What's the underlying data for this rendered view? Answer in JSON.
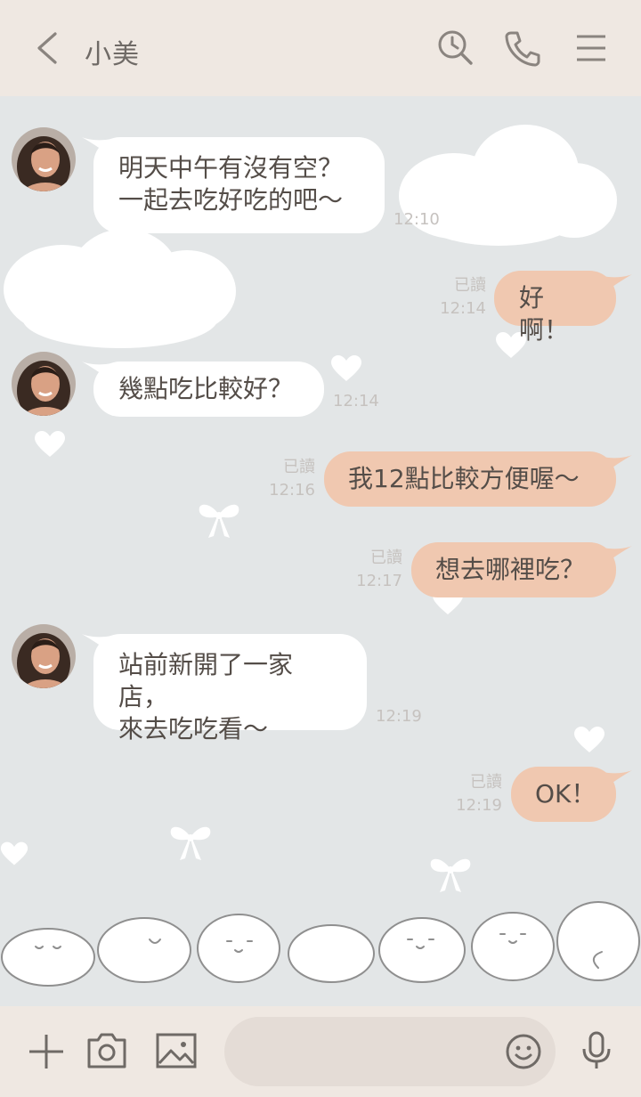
{
  "header": {
    "title": "小美"
  },
  "messages": [
    {
      "dir": "in",
      "text": "明天中午有沒有空？\n一起去吃好吃的吧～",
      "time": "12:10"
    },
    {
      "dir": "out",
      "text": "好啊！",
      "read": "已讀",
      "time": "12:14"
    },
    {
      "dir": "in",
      "text": "幾點吃比較好？",
      "time": "12:14"
    },
    {
      "dir": "out",
      "text": "我12點比較方便喔～",
      "read": "已讀",
      "time": "12:16"
    },
    {
      "dir": "out",
      "text": "想去哪裡吃？",
      "read": "已讀",
      "time": "12:17"
    },
    {
      "dir": "in",
      "text": "站前新開了一家店，\n來去吃吃看～",
      "time": "12:19"
    },
    {
      "dir": "out",
      "text": "OK！",
      "read": "已讀",
      "time": "12:19"
    }
  ],
  "icons": {
    "back": "chevron-left-icon",
    "search": "search-clock-icon",
    "call": "phone-icon",
    "menu": "hamburger-menu-icon",
    "plus": "plus-icon",
    "camera": "camera-icon",
    "image": "image-icon",
    "emoji": "emoji-icon",
    "mic": "microphone-icon"
  },
  "colors": {
    "header_bg": "#efe8e2",
    "chat_bg": "#e3e6e7",
    "bubble_out": "#f0c8b0",
    "bubble_in": "#ffffff",
    "text": "#544d48",
    "meta": "#c6c2bf"
  },
  "composer": {
    "placeholder": ""
  }
}
